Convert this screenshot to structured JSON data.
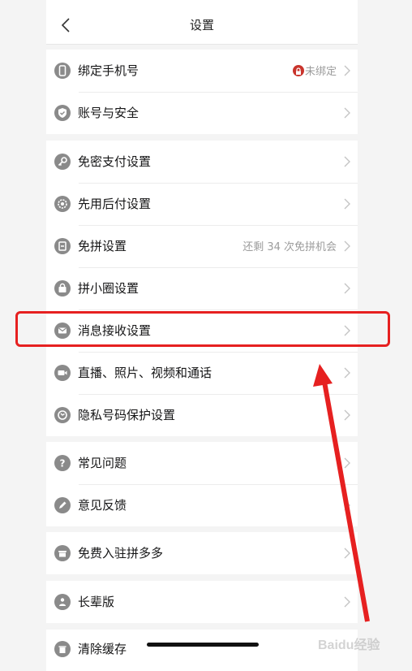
{
  "nav": {
    "title": "设置"
  },
  "groups": [
    {
      "rows": [
        {
          "label": "绑定手机号",
          "icon": "phone-icon",
          "hint": "未绑定",
          "badge": "lock-icon"
        },
        {
          "label": "账号与安全",
          "icon": "shield-check-icon"
        }
      ]
    },
    {
      "rows": [
        {
          "label": "免密支付设置",
          "icon": "key-icon"
        },
        {
          "label": "先用后付设置",
          "icon": "gear-badge-icon"
        },
        {
          "label": "免拼设置",
          "icon": "card-icon",
          "hint": "还剩 34 次免拼机会"
        },
        {
          "label": "拼小圈设置",
          "icon": "bag-icon"
        },
        {
          "label": "消息接收设置",
          "icon": "mail-icon"
        },
        {
          "label": "直播、照片、视频和通话",
          "icon": "video-icon"
        },
        {
          "label": "隐私号码保护设置",
          "icon": "privacy-phone-icon"
        }
      ]
    },
    {
      "rows": [
        {
          "label": "常见问题",
          "icon": "question-icon"
        },
        {
          "label": "意见反馈",
          "icon": "pencil-icon"
        }
      ]
    },
    {
      "rows": [
        {
          "label": "免费入驻拼多多",
          "icon": "store-icon"
        }
      ]
    },
    {
      "rows": [
        {
          "label": "长辈版",
          "icon": "elder-icon"
        }
      ]
    },
    {
      "rows": [
        {
          "label": "清除缓存",
          "icon": "trash-icon"
        }
      ]
    }
  ],
  "colors": {
    "annotation": "#e62020",
    "icon": "#8a8a8a",
    "badge": "#c9342c"
  },
  "watermark": {
    "text": "Baidu经验"
  }
}
